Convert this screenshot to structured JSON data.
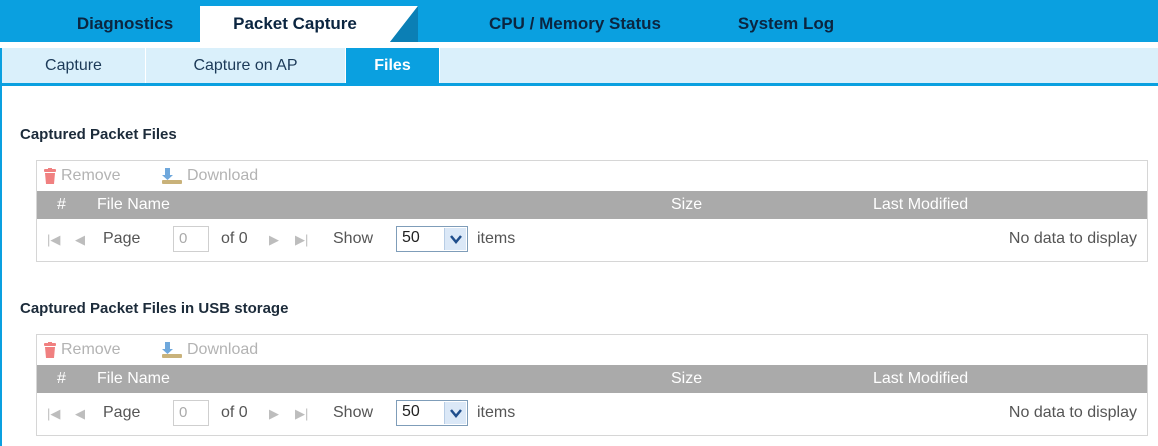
{
  "top_tabs": [
    {
      "label": "Diagnostics"
    },
    {
      "label": "Packet Capture"
    },
    {
      "label": "CPU / Memory Status"
    },
    {
      "label": "System Log"
    }
  ],
  "top_active": "Packet Capture",
  "sub_tabs": [
    {
      "label": "Capture"
    },
    {
      "label": "Capture on AP"
    },
    {
      "label": "Files"
    }
  ],
  "sub_active": "Files",
  "sections": [
    {
      "title": "Captured Packet Files",
      "toolbar": {
        "remove": "Remove",
        "download": "Download"
      },
      "columns": {
        "num": "#",
        "name": "File Name",
        "size": "Size",
        "modified": "Last Modified"
      },
      "pager": {
        "page_label": "Page",
        "page_value": "0",
        "of": "of 0",
        "show": "Show",
        "show_value": "50",
        "items": "items",
        "empty": "No data to display"
      }
    },
    {
      "title": "Captured Packet Files in USB storage",
      "toolbar": {
        "remove": "Remove",
        "download": "Download"
      },
      "columns": {
        "num": "#",
        "name": "File Name",
        "size": "Size",
        "modified": "Last Modified"
      },
      "pager": {
        "page_label": "Page",
        "page_value": "0",
        "of": "of 0",
        "show": "Show",
        "show_value": "50",
        "items": "items",
        "empty": "No data to display"
      }
    }
  ],
  "colors": {
    "accent": "#0aa0e0",
    "header_gray": "#aaaaaa",
    "remove_icon": "#f08080",
    "download_icon": "#6fa8dc"
  },
  "icons": {
    "remove": "trash-icon",
    "download": "download-icon",
    "first": "first-page-icon",
    "prev": "prev-page-icon",
    "next": "next-page-icon",
    "last": "last-page-icon",
    "dropdown": "chevron-down-icon"
  }
}
